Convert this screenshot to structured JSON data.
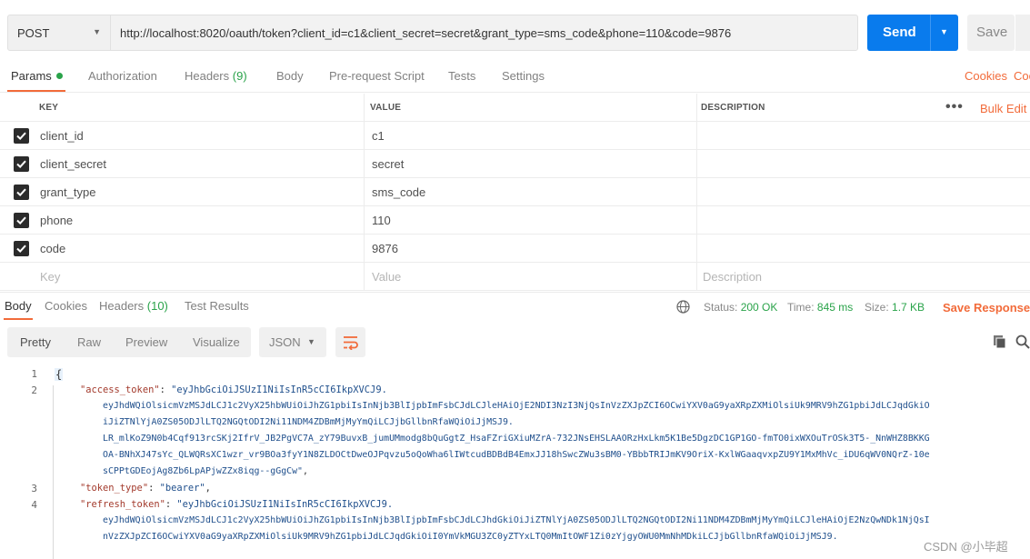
{
  "request": {
    "method": "POST",
    "url": "http://localhost:8020/oauth/token?client_id=c1&client_secret=secret&grant_type=sms_code&phone=110&code=9876",
    "send_label": "Send",
    "save_label": "Save"
  },
  "req_tabs": {
    "params": "Params",
    "authorization": "Authorization",
    "headers": "Headers",
    "headers_count": "(9)",
    "body": "Body",
    "pre_request": "Pre-request Script",
    "tests": "Tests",
    "settings": "Settings",
    "cookies": "Cookies",
    "code": "Coo"
  },
  "params_table": {
    "headers": {
      "key": "KEY",
      "value": "VALUE",
      "description": "DESCRIPTION"
    },
    "bulk_edit": "Bulk Edit",
    "more": "•••",
    "rows": [
      {
        "key": "client_id",
        "value": "c1",
        "checked": true
      },
      {
        "key": "client_secret",
        "value": "secret",
        "checked": true
      },
      {
        "key": "grant_type",
        "value": "sms_code",
        "checked": true
      },
      {
        "key": "phone",
        "value": "110",
        "checked": true
      },
      {
        "key": "code",
        "value": "9876",
        "checked": true
      }
    ],
    "placeholder": {
      "key": "Key",
      "value": "Value",
      "description": "Description"
    }
  },
  "response": {
    "tabs": {
      "body": "Body",
      "cookies": "Cookies",
      "headers": "Headers",
      "headers_count": "(10)",
      "test_results": "Test Results"
    },
    "status_label": "Status:",
    "status_value": "200 OK",
    "time_label": "Time:",
    "time_value": "845 ms",
    "size_label": "Size:",
    "size_value": "1.7 KB",
    "save_response": "Save Response",
    "views": {
      "pretty": "Pretty",
      "raw": "Raw",
      "preview": "Preview",
      "visualize": "Visualize"
    },
    "format": "JSON"
  },
  "code": {
    "line_numbers": [
      "1",
      "2",
      "3",
      "4"
    ],
    "open_brace": "{",
    "access_token_key": "\"access_token\"",
    "access_token_start": "\"eyJhbGciOiJSUzI1NiIsInR5cCI6IkpXVCJ9.",
    "access_token_lines": [
      "eyJhdWQiOlsicmVzMSJdLCJ1c2VyX25hbWUiOiJhZG1pbiIsInNjb3BlIjpbImFsbCJdLCJleHAiOjE2NDI3NzI3NjQsInVzZXJpZCI6OCwiYXV0aG9yaXRpZXMiOlsiUk9MRV9hZG1pbiJdLCJqdGkiO",
      "iJiZTNlYjA0ZS05ODJlLTQ2NGQtODI2Ni11NDM4ZDBmMjMyYmQiLCJjbGllbnRfaWQiOiJjMSJ9.",
      "LR_mlKoZ9N0b4Cqf913rcSKj2IfrV_JB2PgVC7A_zY79BuvxB_jumUMmodg8bQuGgtZ_HsaFZriGXiuMZrA-732JNsEHSLAAORzHxLkm5K1Be5DgzDC1GP1GO-fmTO0ixWXOuTrOSk3T5-_NnWHZ8BKKG",
      "OA-BNhXJ47sYc_QLWQRsXC1wzr_vr9BOa3fyY1N8ZLDOCtDweOJPqvzu5oQoWha6lIWtcudBDBdB4EmxJJ18hSwcZWu3sBM0-YBbbTRIJmKV9OriX-KxlWGaaqvxpZU9Y1MxMhVc_iDU6qWV0NQrZ-10e",
      "sCPPtGDEojAg8Zb6LpAPjwZZx8iqg--gGgCw\""
    ],
    "token_type_key": "\"token_type\"",
    "token_type_value": "\"bearer\"",
    "refresh_token_key": "\"refresh_token\"",
    "refresh_token_start": "\"eyJhbGciOiJSUzI1NiIsInR5cCI6IkpXVCJ9.",
    "refresh_token_lines": [
      "eyJhdWQiOlsicmVzMSJdLCJ1c2VyX25hbWUiOiJhZG1pbiIsInNjb3BlIjpbImFsbCJdLCJhdGkiOiJiZTNlYjA0ZS05ODJlLTQ2NGQtODI2Ni11NDM4ZDBmMjMyYmQiLCJleHAiOjE2NzQwNDk1NjQsI",
      "nVzZXJpZCI6OCwiYXV0aG9yaXRpZXMiOlsiUk9MRV9hZG1pbiJdLCJqdGkiOiI0YmVkMGU3ZC0yZTYxLTQ0MmItOWF1Zi0zYjgyOWU0MmNhMDkiLCJjbGllbnRfaWQiOiJjMSJ9."
    ]
  },
  "watermark": "CSDN @小毕超",
  "colors": {
    "accent": "#f26b3a",
    "send": "#097bed",
    "success": "#2aa34a"
  }
}
